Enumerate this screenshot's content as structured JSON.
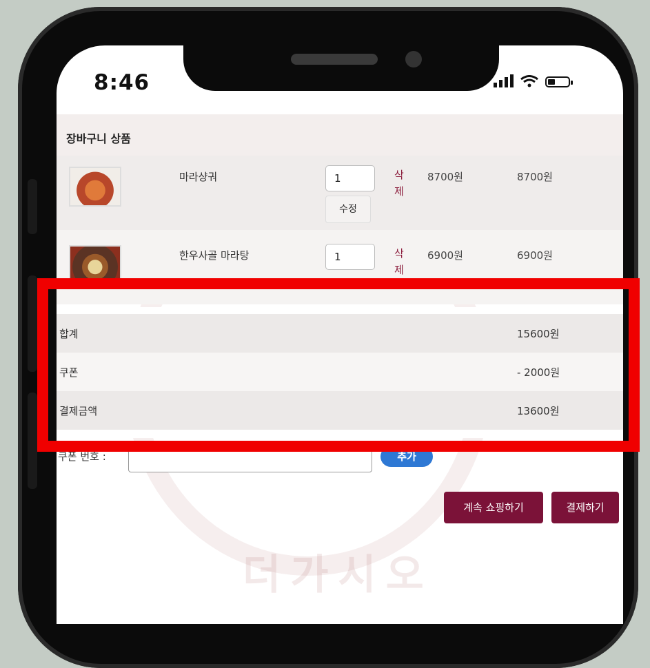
{
  "status": {
    "time": "8:46"
  },
  "cart": {
    "section_title": "장바구니 상품",
    "items": [
      {
        "name": "마라샹궈",
        "qty": "1",
        "edit_label": "수정",
        "delete_label": "삭제",
        "price": "8700원",
        "total": "8700원"
      },
      {
        "name": "한우사골 마라탕",
        "qty": "1",
        "delete_label": "삭제",
        "price": "6900원",
        "total": "6900원"
      }
    ]
  },
  "summary": {
    "subtotal_label": "합계",
    "subtotal_value": "15600원",
    "coupon_label": "쿠폰",
    "coupon_value": "- 2000원",
    "payment_label": "결제금액",
    "payment_value": "13600원"
  },
  "coupon": {
    "label": "쿠폰 번호 :",
    "add_label": "추가"
  },
  "actions": {
    "continue_label": "계속 쇼핑하기",
    "checkout_label": "결제하기"
  },
  "watermark": {
    "text": "더가시오"
  },
  "colors": {
    "highlight": "#f00000",
    "accent": "#7b1238",
    "delete": "#8a1a3a",
    "add_button": "#2e78d4"
  }
}
